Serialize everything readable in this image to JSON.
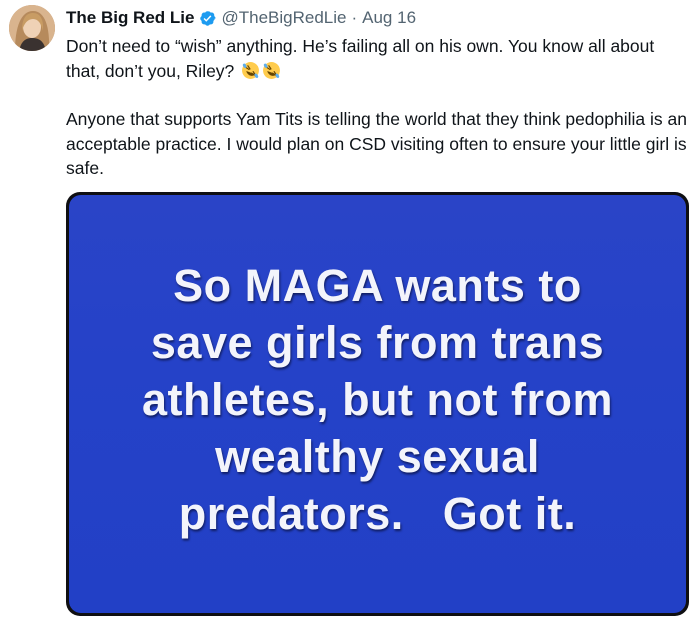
{
  "tweet": {
    "author": {
      "display_name": "The Big Red Lie",
      "handle": "@TheBigRedLie",
      "verified_icon": "verified-badge-icon"
    },
    "separator": "·",
    "date": "Aug 16",
    "paragraphs": [
      "Don’t need to “wish” anything.  He’s failing all on his own.  You know all about that, don’t you, Riley?",
      "Anyone that supports Yam Tits is telling the world that they think pedophilia is an acceptable practice.  I would plan on CSD visiting often to ensure your little girl is safe."
    ],
    "emoji": [
      "rolling-on-floor-laughing-emoji",
      "rolling-on-floor-laughing-emoji"
    ],
    "media": {
      "lines": [
        "So MAGA wants to",
        "save girls from trans",
        "athletes, but not from",
        "wealthy sexual",
        "predators.   Got it."
      ]
    }
  },
  "colors": {
    "verified_blue": "#1d9bf0",
    "secondary_text": "#536471",
    "meme_background": "#2542c8",
    "meme_text": "#f3f4fb"
  }
}
